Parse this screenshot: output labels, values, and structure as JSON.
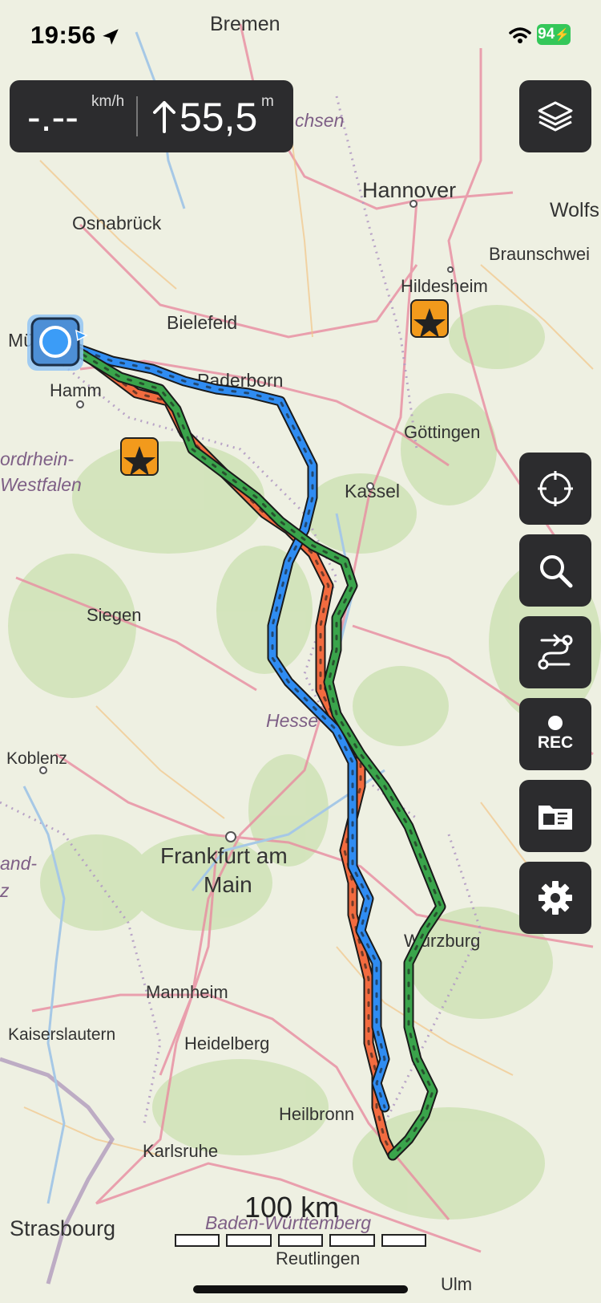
{
  "status": {
    "time": "19:56",
    "battery": "94"
  },
  "speed_panel": {
    "speed_value": "-.--",
    "speed_unit": "km/h",
    "altitude_value": "55,5",
    "altitude_unit": "m"
  },
  "map": {
    "cities": [
      "Bremen",
      "Hannover",
      "Wolfs",
      "Osnabrück",
      "Braunschwei",
      "Hildesheim",
      "Bielefeld",
      "Mü",
      "Paderborn",
      "Hamm",
      "Göttingen",
      "Kassel",
      "Siegen",
      "Koblenz",
      "Frankfurt am",
      "Main",
      "Würzburg",
      "Mannheim",
      "Kaiserslautern",
      "Heidelberg",
      "Heilbronn",
      "Karlsruhe",
      "Strasbourg",
      "Reutlingen",
      "Ulm"
    ],
    "regions": [
      "chsen",
      "ordrhein-",
      "Westfalen",
      "Hesse",
      "and-",
      "z",
      "Baden-Württemberg"
    ],
    "track_colors": {
      "blue": "#2f8cf2",
      "orange": "#f26b3f",
      "green": "#3aa44b"
    }
  },
  "buttons": {
    "rec_label": "REC"
  },
  "scale": {
    "label": "100 km"
  }
}
